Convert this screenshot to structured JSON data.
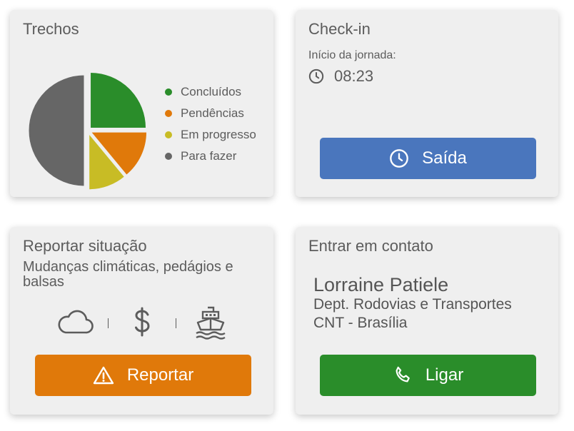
{
  "trechos": {
    "title": "Trechos",
    "legend": [
      {
        "label": "Concluídos",
        "color": "#2a8d2a",
        "value": 25
      },
      {
        "label": "Pendências",
        "color": "#e0790a",
        "value": 14
      },
      {
        "label": "Em progresso",
        "color": "#c8bc25",
        "value": 11
      },
      {
        "label": "Para fazer",
        "color": "#666666",
        "value": 50
      }
    ]
  },
  "checkin": {
    "title": "Check-in",
    "start_label": "Início da jornada:",
    "start_time": "08:23",
    "button_label": "Saída",
    "icons": {
      "time": "clock-icon",
      "button": "clock-icon"
    }
  },
  "reportar": {
    "title": "Reportar situação",
    "subtitle": "Mudanças climáticas, pedágios e balsas",
    "icons": [
      "cloud-icon",
      "dollar-icon",
      "ferry-icon"
    ],
    "button_label": "Reportar",
    "button_icon": "warning-icon"
  },
  "contato": {
    "title": "Entrar em contato",
    "name": "Lorraine Patiele",
    "dept": "Dept. Rodovias e Transportes",
    "location": "CNT - Brasília",
    "button_label": "Ligar",
    "button_icon": "phone-icon"
  },
  "colors": {
    "card_bg": "#efefef",
    "blue": "#4a76bd",
    "orange": "#e0790a",
    "green": "#2a8d2a",
    "text": "#5c5c5c"
  }
}
